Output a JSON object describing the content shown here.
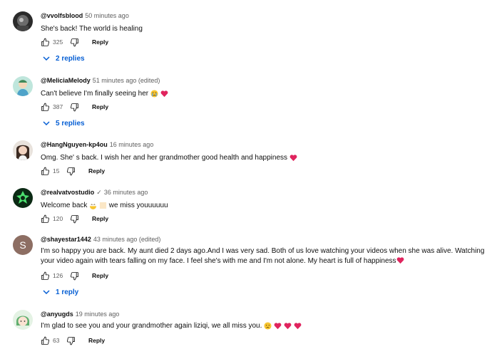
{
  "comments": [
    {
      "author": "@vvolfsblood",
      "time": "50 minutes ago",
      "text": "She's back! The world is healing",
      "likes": "325",
      "reply_label": "Reply",
      "replies": "2 replies"
    },
    {
      "author": "@MeliciaMelody",
      "time": "51 minutes ago (edited)",
      "text": "Can't believe I'm finally seeing her",
      "likes": "387",
      "reply_label": "Reply",
      "replies": "5 replies"
    },
    {
      "author": "@HangNguyen-kp4ou",
      "time": "16 minutes ago",
      "text": "Omg. She' s back. I wish her and her grandmother good health and happiness",
      "likes": "15",
      "reply_label": "Reply"
    },
    {
      "author": "@realvatvostudio",
      "time": "36 minutes ago",
      "text_before": "Welcome back",
      "text_after": "we miss youuuuuu",
      "likes": "120",
      "reply_label": "Reply"
    },
    {
      "author": "@shayestar1442",
      "time": "43 minutes ago (edited)",
      "avatar_letter": "S",
      "text": "I'm so happy you are back. My aunt died 2 days ago.And I was very sad. Both of us love watching your videos when she was alive. Watching your video again with tears falling on my face. I feel she's with me and I'm not alone. My heart is full of happiness",
      "likes": "126",
      "reply_label": "Reply",
      "replies": "1 reply"
    },
    {
      "author": "@anyugds",
      "time": "19 minutes ago",
      "text": "I'm glad to see you and your grandmother again liziqi, we all miss you.",
      "likes": "63",
      "reply_label": "Reply"
    }
  ],
  "colors": {
    "link_blue": "#065fd4",
    "meta_gray": "#606060",
    "heart_red": "#e0245e",
    "avatar_s": "#8d6e63"
  }
}
